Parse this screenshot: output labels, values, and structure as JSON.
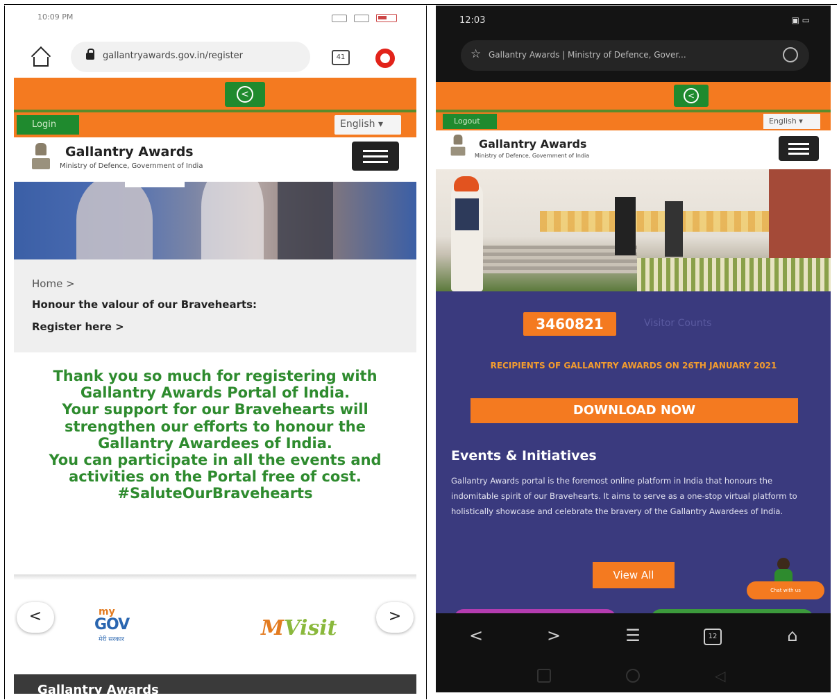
{
  "left": {
    "status": {
      "time": "10:09 PM"
    },
    "url": "gallantryawards.gov.in/register",
    "tab_count": "41",
    "login_label": "Login",
    "language": "English ▾",
    "brand": {
      "title": "Gallantry Awards",
      "subtitle": "Ministry of Defence, Government of India"
    },
    "breadcrumb": {
      "home": "Home  >",
      "title": "Honour the valour of our Bravehearts:",
      "register": "Register here  >"
    },
    "thanks": [
      "Thank you so much for registering with Gallantry Awards Portal of India.",
      "Your support for our Bravehearts will strengthen our efforts to honour the Gallantry Awardees of India.",
      "You can participate in all the events and activities on the Portal free of cost.",
      "#SaluteOurBravehearts"
    ],
    "partners": {
      "mygov_top": "my",
      "mygov_main": "GOV",
      "mygov_hindi": "मेरी सरकार",
      "myvisit_m": "M",
      "myvisit_rest": "Visit"
    },
    "prev_label": "<",
    "next_label": ">",
    "footer_title": "Gallantry Awards"
  },
  "right": {
    "status": {
      "time": "12:03",
      "icons": "▣ ▭"
    },
    "page_title": "Gallantry Awards | Ministry of Defence, Gover...",
    "logout_label": "Logout",
    "language": "English ▾",
    "brand": {
      "title": "Gallantry Awards",
      "subtitle": "Ministry of Defence, Government of India"
    },
    "counter": "3460821",
    "counter_label": "Visitor Counts",
    "recipients": "RECIPIENTS OF GALLANTRY AWARDS ON 26TH JANUARY 2021",
    "download_label": "DOWNLOAD NOW",
    "events_title": "Events & Initiatives",
    "events_body": "Gallantry Awards portal is the foremost online platform in India that honours the indomitable spirit of our Bravehearts. It aims to serve as a one-stop virtual platform to holistically showcase and celebrate the bravery of the Gallantry Awardees of India.",
    "view_all_label": "View All",
    "mascot_text": "Chat with us",
    "nav": {
      "back": "<",
      "forward": ">",
      "menu": "☰",
      "tabs": "12",
      "home": "⌂"
    }
  },
  "colors": {
    "saffron": "#f47a20",
    "green": "#1f8a2e",
    "navy": "#3a3a7e"
  }
}
